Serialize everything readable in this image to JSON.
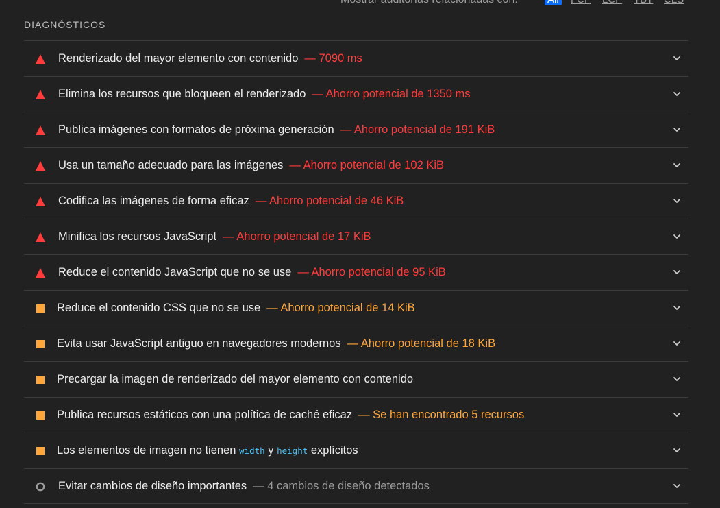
{
  "header": {
    "show_label": "Mostrar auditorías relacionadas con:",
    "filters": [
      "All",
      "FCP",
      "LCP",
      "TBT",
      "CLS"
    ],
    "active_filter": "All"
  },
  "section": {
    "title": "DIAGNÓSTICOS"
  },
  "colors": {
    "fail": "#ff3b3b",
    "average": "#ffa63a",
    "neutral": "#9a9a9a",
    "code": "#4fc3f7"
  },
  "audits": [
    {
      "title": "Renderizado del mayor elemento con contenido",
      "separator": "—",
      "display": "7090 ms",
      "status": "fail",
      "icon": "red-triangle-icon"
    },
    {
      "title": "Elimina los recursos que bloqueen el renderizado",
      "separator": "—",
      "display": "Ahorro potencial de 1350 ms",
      "status": "fail",
      "icon": "red-triangle-icon"
    },
    {
      "title": "Publica imágenes con formatos de próxima generación",
      "separator": "—",
      "display": "Ahorro potencial de 191 KiB",
      "status": "fail",
      "icon": "red-triangle-icon"
    },
    {
      "title": "Usa un tamaño adecuado para las imágenes",
      "separator": "—",
      "display": "Ahorro potencial de 102 KiB",
      "status": "fail",
      "icon": "red-triangle-icon"
    },
    {
      "title": "Codifica las imágenes de forma eficaz",
      "separator": "—",
      "display": "Ahorro potencial de 46 KiB",
      "status": "fail",
      "icon": "red-triangle-icon"
    },
    {
      "title": "Minifica los recursos JavaScript",
      "separator": "—",
      "display": "Ahorro potencial de 17 KiB",
      "status": "fail",
      "icon": "red-triangle-icon"
    },
    {
      "title": "Reduce el contenido JavaScript que no se use",
      "separator": "—",
      "display": "Ahorro potencial de 95 KiB",
      "status": "fail",
      "icon": "red-triangle-icon"
    },
    {
      "title": "Reduce el contenido CSS que no se use",
      "separator": "—",
      "display": "Ahorro potencial de 14 KiB",
      "status": "avg",
      "icon": "orange-square-icon"
    },
    {
      "title": "Evita usar JavaScript antiguo en navegadores modernos",
      "separator": "—",
      "display": "Ahorro potencial de 18 KiB",
      "status": "avg",
      "icon": "orange-square-icon"
    },
    {
      "title": "Precargar la imagen de renderizado del mayor elemento con contenido",
      "separator": "",
      "display": "",
      "status": "avg",
      "icon": "orange-square-icon"
    },
    {
      "title": "Publica recursos estáticos con una política de caché eficaz",
      "separator": "—",
      "display": "Se han encontrado 5 recursos",
      "status": "avg",
      "icon": "orange-square-icon"
    },
    {
      "title_parts": [
        "Los elementos de imagen no tienen",
        "width",
        "y",
        "height",
        "explícitos"
      ],
      "status": "avg",
      "icon": "orange-square-icon"
    },
    {
      "title": "Evitar cambios de diseño importantes",
      "separator": "—",
      "display": "4 cambios de diseño detectados",
      "status": "pass",
      "icon": "gray-circle-icon"
    }
  ]
}
